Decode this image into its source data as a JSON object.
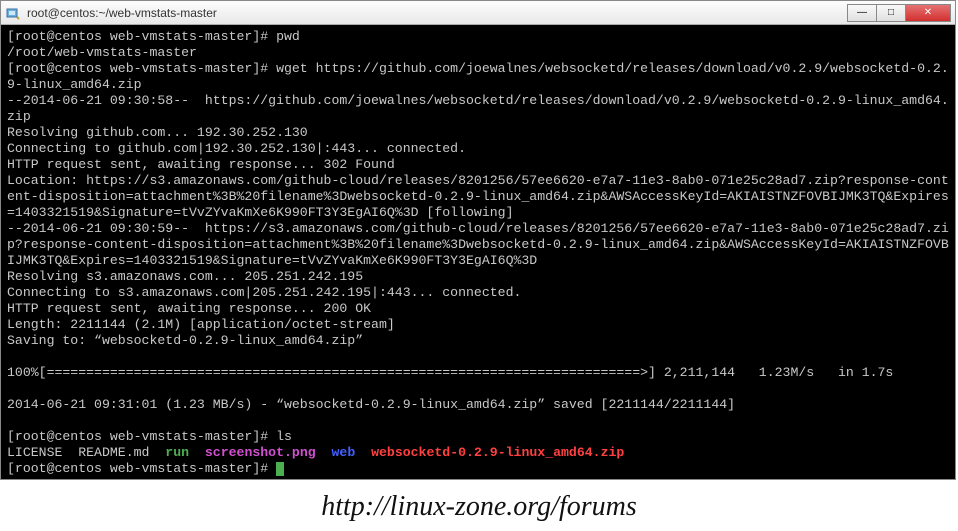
{
  "window": {
    "title": "root@centos:~/web-vmstats-master",
    "icon_name": "putty-icon"
  },
  "buttons": {
    "minimize": "—",
    "maximize": "□",
    "close": "✕"
  },
  "terminal": {
    "line1": "[root@centos web-vmstats-master]# pwd",
    "line2": "/root/web-vmstats-master",
    "line3": "[root@centos web-vmstats-master]# wget https://github.com/joewalnes/websocketd/releases/download/v0.2.9/websocketd-0.2.9-linux_amd64.zip",
    "line4": "--2014-06-21 09:30:58--  https://github.com/joewalnes/websocketd/releases/download/v0.2.9/websocketd-0.2.9-linux_amd64.zip",
    "line5": "Resolving github.com... 192.30.252.130",
    "line6": "Connecting to github.com|192.30.252.130|:443... connected.",
    "line7": "HTTP request sent, awaiting response... 302 Found",
    "line8": "Location: https://s3.amazonaws.com/github-cloud/releases/8201256/57ee6620-e7a7-11e3-8ab0-071e25c28ad7.zip?response-content-disposition=attachment%3B%20filename%3Dwebsocketd-0.2.9-linux_amd64.zip&AWSAccessKeyId=AKIAISTNZFOVBIJMK3TQ&Expires=1403321519&Signature=tVvZYvaKmXe6K990FT3Y3EgAI6Q%3D [following]",
    "line9": "--2014-06-21 09:30:59--  https://s3.amazonaws.com/github-cloud/releases/8201256/57ee6620-e7a7-11e3-8ab0-071e25c28ad7.zip?response-content-disposition=attachment%3B%20filename%3Dwebsocketd-0.2.9-linux_amd64.zip&AWSAccessKeyId=AKIAISTNZFOVBIJMK3TQ&Expires=1403321519&Signature=tVvZYvaKmXe6K990FT3Y3EgAI6Q%3D",
    "line10": "Resolving s3.amazonaws.com... 205.251.242.195",
    "line11": "Connecting to s3.amazonaws.com|205.251.242.195|:443... connected.",
    "line12": "HTTP request sent, awaiting response... 200 OK",
    "line13": "Length: 2211144 (2.1M) [application/octet-stream]",
    "line14": "Saving to: “websocketd-0.2.9-linux_amd64.zip”",
    "line15": "",
    "line16": "100%[===========================================================================>] 2,211,144   1.23M/s   in 1.7s",
    "line17": "",
    "line18": "2014-06-21 09:31:01 (1.23 MB/s) - “websocketd-0.2.9-linux_amd64.zip” saved [2211144/2211144]",
    "line19": "",
    "line20": "[root@centos web-vmstats-master]# ls",
    "ls": {
      "license": "LICENSE",
      "readme": "README.md",
      "run": "run",
      "screenshot": "screenshot.png",
      "web": "web",
      "zip": "websocketd-0.2.9-linux_amd64.zip"
    },
    "line22": "[root@centos web-vmstats-master]# "
  },
  "watermark": "http://linux-zone.org/forums"
}
